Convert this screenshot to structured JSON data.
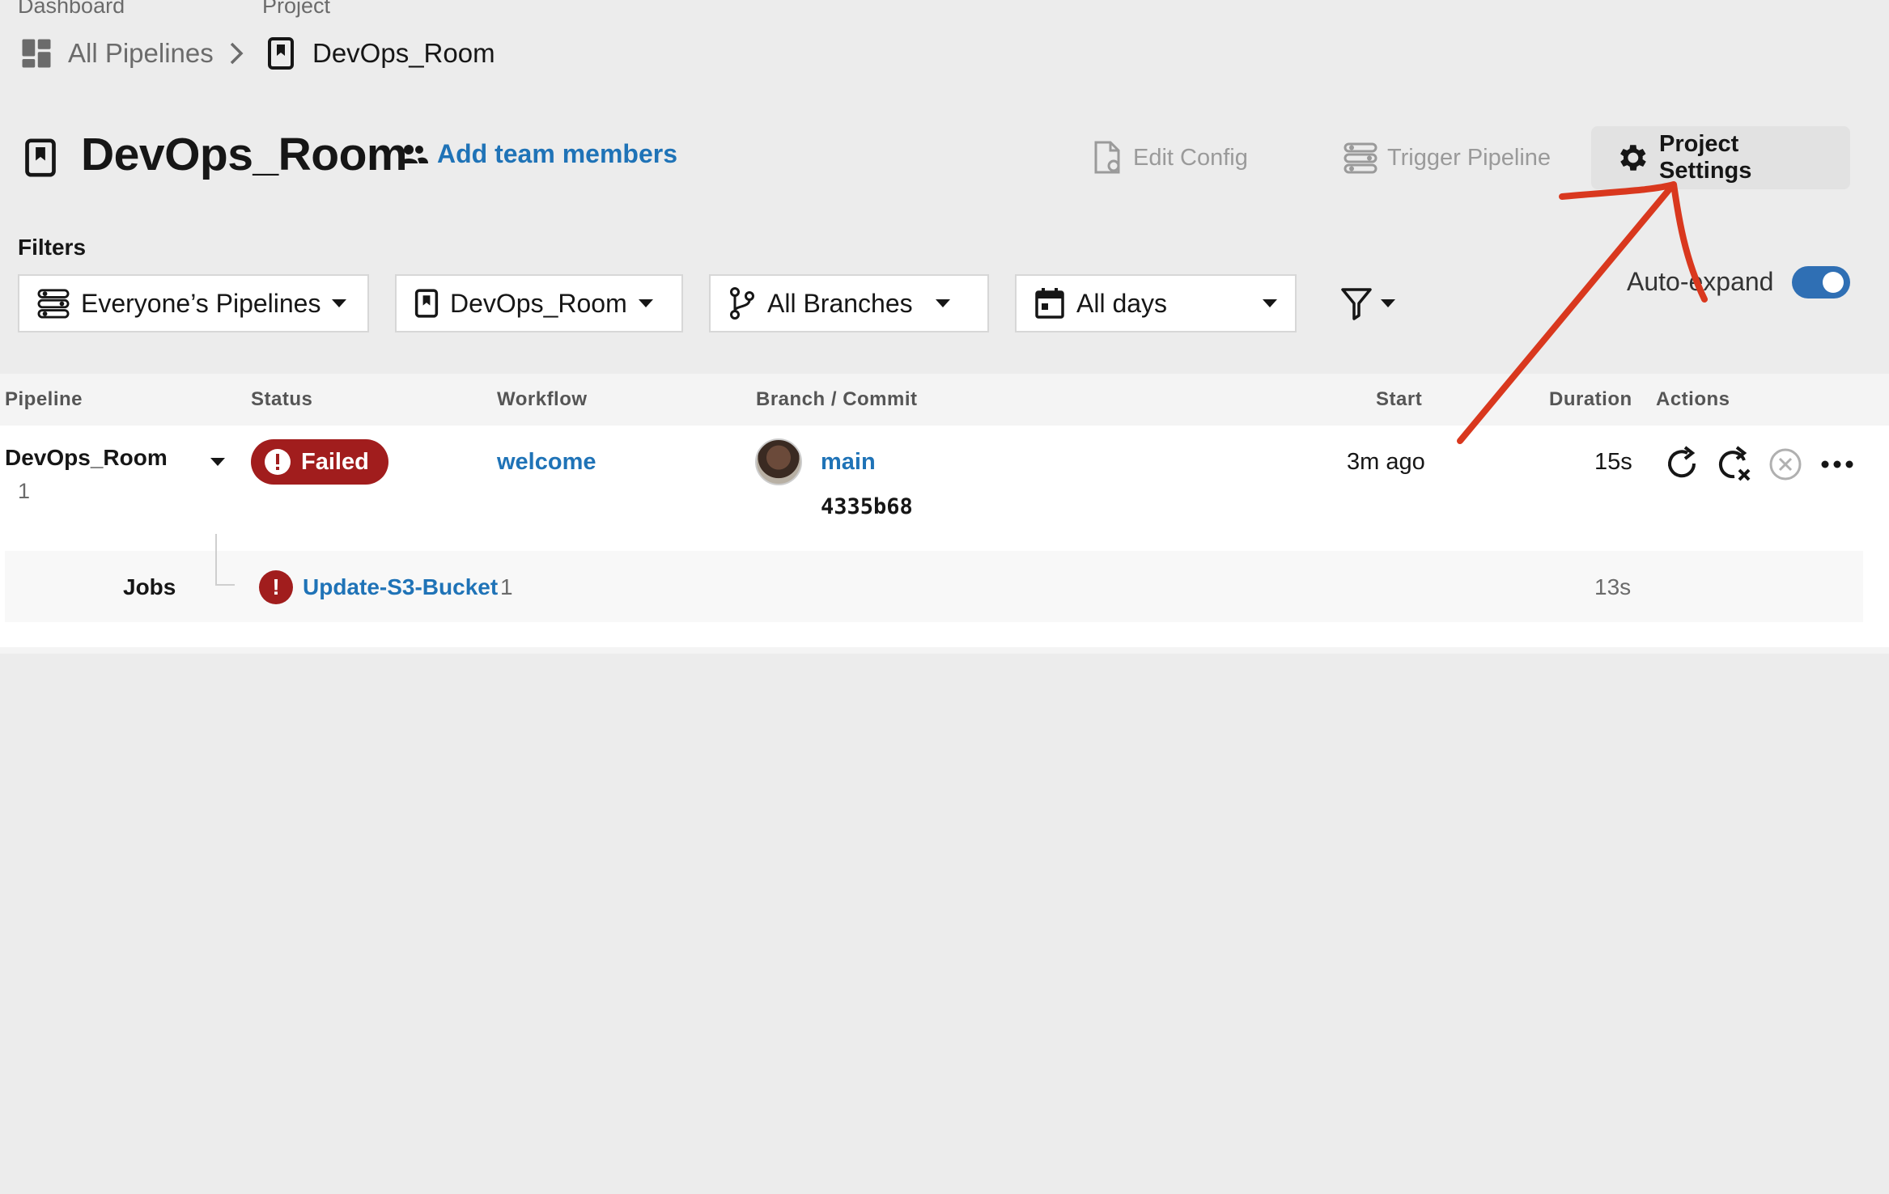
{
  "breadcrumb": {
    "dashboard_label": "Dashboard",
    "project_label": "Project",
    "all_pipelines": "All Pipelines",
    "current_project": "DevOps_Room"
  },
  "header": {
    "title": "DevOps_Room",
    "add_team_members": "Add team members",
    "edit_config": "Edit Config",
    "trigger_pipeline": "Trigger Pipeline",
    "project_settings": "Project Settings"
  },
  "filters": {
    "label": "Filters",
    "pipelines": "Everyone’s Pipelines",
    "project": "DevOps_Room",
    "branches": "All Branches",
    "days": "All days",
    "auto_expand": "Auto-expand",
    "auto_expand_on": true
  },
  "table": {
    "headers": [
      "Pipeline",
      "Status",
      "Workflow",
      "Branch / Commit",
      "Start",
      "Duration",
      "Actions"
    ],
    "rows": [
      {
        "pipeline": "DevOps_Room",
        "number": "1",
        "status": "Failed",
        "workflow": "welcome",
        "branch": "main",
        "commit": "4335b68",
        "start": "3m ago",
        "duration": "15s",
        "jobs_label": "Jobs",
        "jobs": [
          {
            "name": "Update-S3-Bucket",
            "number": "1",
            "duration": "13s"
          }
        ]
      }
    ]
  },
  "colors": {
    "background": "#ececec",
    "link_blue": "#1f73b7",
    "failed_red": "#a11d1d",
    "toggle_blue": "#2f6fb4",
    "annotation_red": "#d9381e"
  },
  "icons": [
    "dashboard-icon",
    "chevron-right-icon",
    "project-bookmark-icon",
    "people-icon",
    "edit-config-icon",
    "pipeline-icon",
    "gear-icon",
    "branch-icon",
    "calendar-icon",
    "filter-icon",
    "rerun-icon",
    "rerun-failed-icon",
    "cancel-icon",
    "more-icon",
    "alert-icon"
  ]
}
